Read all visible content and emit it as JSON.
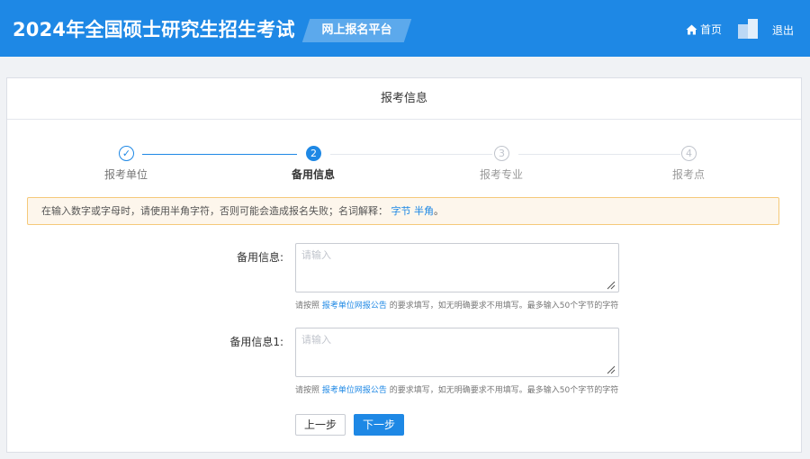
{
  "header": {
    "title": "2024年全国硕士研究生招生考试",
    "platform": "网上报名平台",
    "home_label": "首页",
    "logout_label": "退出"
  },
  "card": {
    "title": "报考信息"
  },
  "steps": [
    {
      "number": "✓",
      "label": "报考单位",
      "status": "done"
    },
    {
      "number": "2",
      "label": "备用信息",
      "status": "active"
    },
    {
      "number": "3",
      "label": "报考专业",
      "status": "wait"
    },
    {
      "number": "4",
      "label": "报考点",
      "status": "wait"
    }
  ],
  "alert": {
    "text": "在输入数字或字母时，请使用半角字符，否则可能会造成报名失败；名词解释：",
    "link1": "字节",
    "link2": "半角",
    "end": "。"
  },
  "fields": [
    {
      "label": "备用信息:",
      "placeholder": "请输入",
      "value": "",
      "hint_pre": "请按照 ",
      "hint_link": "报考单位网报公告",
      "hint_post": " 的要求填写，如无明确要求不用填写。最多输入50个字节的字符"
    },
    {
      "label": "备用信息1:",
      "placeholder": "请输入",
      "value": "",
      "hint_pre": "请按照 ",
      "hint_link": "报考单位网报公告",
      "hint_post": " 的要求填写，如无明确要求不用填写。最多输入50个字节的字符"
    }
  ],
  "buttons": {
    "prev": "上一步",
    "next": "下一步"
  },
  "colors": {
    "primary": "#1e88e5",
    "alert_bg": "#fdf6ec",
    "alert_border": "#f5c97a"
  }
}
